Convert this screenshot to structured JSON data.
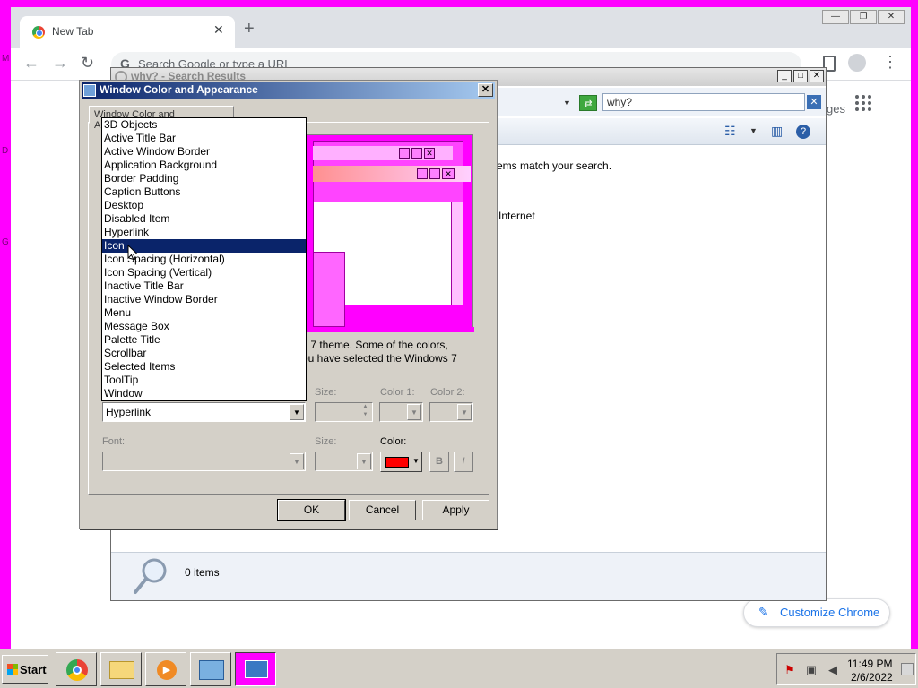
{
  "desktop": {
    "fragments": [
      "M",
      "D",
      "G"
    ]
  },
  "chrome": {
    "tab_title": "New Tab",
    "tab_close": "✕",
    "new_tab": "+",
    "window_controls": [
      "—",
      "❐",
      "✕"
    ],
    "nav": {
      "back": "←",
      "forward": "→",
      "reload": "↻"
    },
    "omnibox_placeholder": "Search Google or type a URL",
    "omnibox_g": "G",
    "ntp_fragment": "ges",
    "customize_label": "Customize Chrome",
    "customize_icon": "✎"
  },
  "explorer": {
    "title": "why? - Search Results",
    "window_controls": [
      "_",
      "□",
      "✕"
    ],
    "search_value": "why?",
    "search_clear": "✕",
    "message": "ems match your search.",
    "internet_label": "Internet",
    "item_count": "0 items"
  },
  "dialog": {
    "title": "Window Color and Appearance",
    "close": "✕",
    "tab_label": "Window Color and Appearance",
    "description_line1": "s 7 theme.  Some of the colors,",
    "description_line2": "ou have selected the Windows 7",
    "labels": {
      "size1": "Size:",
      "color1": "Color 1:",
      "color2": "Color 2:",
      "font": "Font:",
      "size2": "Size:",
      "color": "Color:"
    },
    "selected_item": "Hyperlink",
    "bold_label": "B",
    "italic_label": "I",
    "accent_color": "#ff0000",
    "buttons": {
      "ok": "OK",
      "cancel": "Cancel",
      "apply": "Apply"
    },
    "item_list": [
      "3D Objects",
      "Active Title Bar",
      "Active Window Border",
      "Application Background",
      "Border Padding",
      "Caption Buttons",
      "Desktop",
      "Disabled Item",
      "Hyperlink",
      "Icon",
      "Icon Spacing (Horizontal)",
      "Icon Spacing (Vertical)",
      "Inactive Title Bar",
      "Inactive Window Border",
      "Menu",
      "Message Box",
      "Palette Title",
      "Scrollbar",
      "Selected Items",
      "ToolTip",
      "Window"
    ],
    "highlighted_index": 9
  },
  "taskbar": {
    "start_label": "Start",
    "apps": [
      "chrome-icon",
      "folder-icon",
      "media-player-icon",
      "control-panel-icon",
      "display-settings-icon"
    ],
    "clock_time": "11:49 PM",
    "clock_date": "2/6/2022"
  }
}
